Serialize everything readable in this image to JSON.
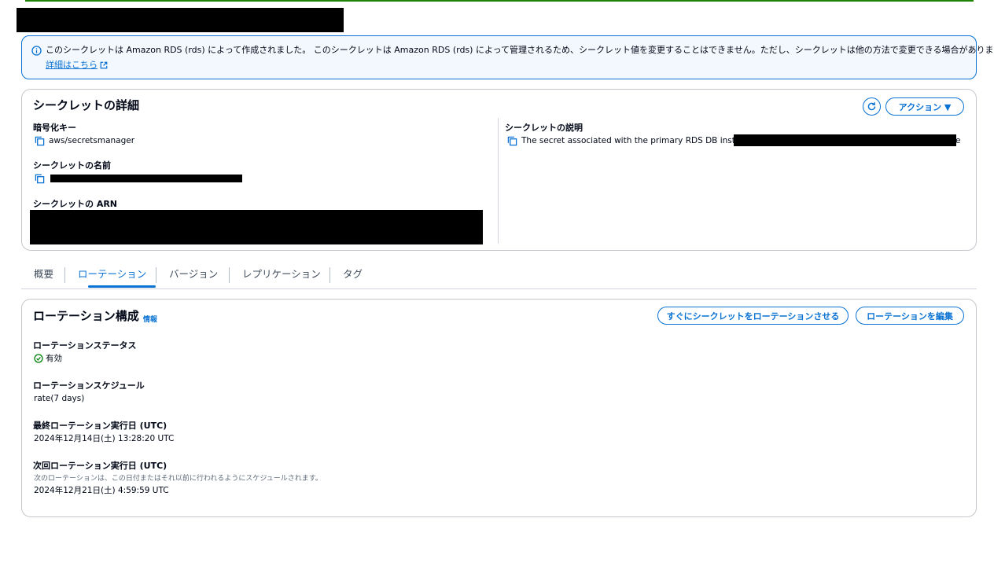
{
  "banner": {
    "message": "このシークレットは Amazon RDS (rds) によって作成されました。 このシークレットは Amazon RDS (rds) によって管理されるため、シークレット値を変更することはできません。ただし、シークレットは他の方法で変更できる場合があります。",
    "link_label": "詳細はこちら",
    "icon": "info-icon"
  },
  "details": {
    "title": "シークレットの詳細",
    "refresh_icon": "refresh-icon",
    "actions_label": "アクション ▼",
    "encryption_key_label": "暗号化キー",
    "encryption_key_value": "aws/secretsmanager",
    "name_label": "シークレットの名前",
    "arn_label": "シークレットの ARN",
    "description_label": "シークレットの説明",
    "description_value": "The secret associated with the primary RDS DB instance:",
    "description_tail": "e"
  },
  "tabs": [
    {
      "label": "概要"
    },
    {
      "label": "ローテーション"
    },
    {
      "label": "バージョン"
    },
    {
      "label": "レプリケーション"
    },
    {
      "label": "タグ"
    }
  ],
  "rotation": {
    "title": "ローテーション構成",
    "info_label": "情報",
    "rotate_now_label": "すぐにシークレットをローテーションさせる",
    "edit_label": "ローテーションを編集",
    "status_label": "ローテーションステータス",
    "status_value": "有効",
    "schedule_label": "ローテーションスケジュール",
    "schedule_value": "rate(7 days)",
    "last_label": "最終ローテーション実行日 (UTC)",
    "last_value": "2024年12月14日(土) 13:28:20 UTC",
    "next_label": "次回ローテーション実行日 (UTC)",
    "next_note": "次のローテーションは、この日付またはそれ以前に行われるようにスケジュールされます。",
    "next_value": "2024年12月21日(土) 4:59:59 UTC"
  },
  "colors": {
    "accent": "#0972d3",
    "success": "#037f0c",
    "top_bar": "#1d8102"
  }
}
